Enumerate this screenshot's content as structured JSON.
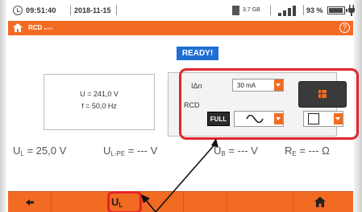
{
  "status_bar": {
    "time": "09:51:40",
    "date": "2018-11-15",
    "storage": "3.7 GB",
    "battery": "93 %"
  },
  "title_bar": {
    "title": "RCD",
    "subtitle": "AUTO"
  },
  "main": {
    "status": "READY!",
    "result": {
      "voltage": "U = 241,0 V",
      "frequency": "f = 50,0 Hz"
    },
    "settings": {
      "idn_label": "IΔn",
      "idn_value": "30 mA",
      "rcd_label": "RCD",
      "full_label": "FULL"
    },
    "readings": [
      {
        "symbol": "U",
        "sub": "L",
        "value": " = 25,0 V"
      },
      {
        "symbol": "U",
        "sub": "L-PE",
        "value": " = --- V"
      },
      {
        "symbol": "U",
        "sub": "B",
        "value": " = --- V"
      },
      {
        "symbol": "R",
        "sub": "E",
        "value": " = --- Ω"
      }
    ]
  },
  "bottom_bar": {
    "ul_symbol": "U",
    "ul_sub": "L"
  },
  "colors": {
    "accent": "#f26b22",
    "ready": "#1f6fd3",
    "highlight": "#e3252b"
  },
  "icons": [
    "clock-icon",
    "sd-card-icon",
    "signal-icon",
    "battery-icon",
    "plug-icon",
    "home-icon",
    "help-icon",
    "start-icon",
    "sine-wave-icon",
    "back-arrow-icon"
  ]
}
